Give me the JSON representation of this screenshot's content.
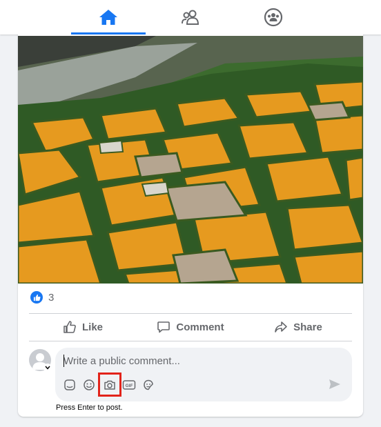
{
  "nav": {
    "tabs": [
      {
        "name": "Home",
        "icon": "home-icon",
        "active": true
      },
      {
        "name": "Friends",
        "icon": "friends-icon",
        "active": false
      },
      {
        "name": "Groups",
        "icon": "groups-icon",
        "active": false
      }
    ]
  },
  "post": {
    "image": {
      "description_icon": "aerial-fields-photo"
    },
    "reaction_count": "3",
    "actions": {
      "like": "Like",
      "comment": "Comment",
      "share": "Share"
    }
  },
  "comment": {
    "placeholder": "Write a public comment...",
    "tools": [
      "sticker-icon",
      "emoji-icon",
      "camera-icon",
      "gif-icon",
      "avatar-sticker-icon"
    ],
    "highlighted_tool": "camera-icon",
    "hint": "Press Enter to post."
  },
  "colors": {
    "accent": "#1877f2",
    "highlight": "#e2231a",
    "secondary_text": "#65676b"
  }
}
